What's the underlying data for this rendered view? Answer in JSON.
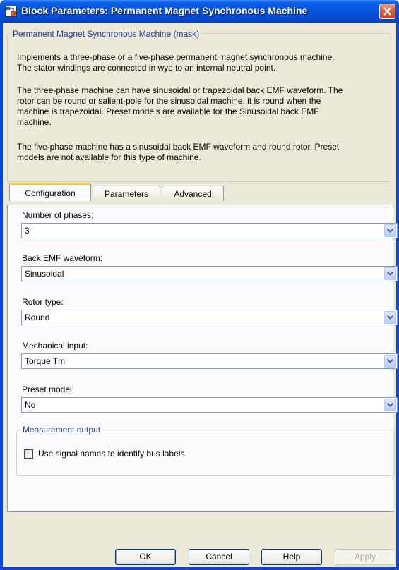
{
  "window": {
    "title": "Block Parameters: Permanent Magnet Synchronous Machine",
    "mask_title": "Permanent Magnet Synchronous Machine (mask)",
    "description": [
      "Implements a three-phase or a five-phase permanent magnet synchronous machine.",
      "The stator windings are connected in wye to an internal neutral point.",
      "The three-phase machine can have sinusoidal or trapezoidal back EMF waveform. The",
      "rotor can be round or salient-pole for the sinusoidal machine, it is round when the",
      "machine is trapezoidal. Preset models are available for the Sinusoidal back EMF",
      "machine.",
      "The five-phase machine has a sinusoidal back EMF waveform and round rotor. Preset",
      "models are not available for this type of machine."
    ]
  },
  "tabs": [
    {
      "label": "Configuration",
      "active": true
    },
    {
      "label": "Parameters",
      "active": false
    },
    {
      "label": "Advanced",
      "active": false
    }
  ],
  "fields": [
    {
      "label": "Number of phases:",
      "value": "3"
    },
    {
      "label": "Back EMF waveform:",
      "value": "Sinusoidal"
    },
    {
      "label": "Rotor type:",
      "value": "Round"
    },
    {
      "label": "Mechanical input:",
      "value": "Torque Tm"
    },
    {
      "label": "Preset model:",
      "value": "No"
    }
  ],
  "measurement": {
    "legend": "Measurement output",
    "checkbox_label": "Use signal names to identify bus labels",
    "checked": false
  },
  "buttons": {
    "ok": "OK",
    "cancel": "Cancel",
    "help": "Help",
    "apply": "Apply"
  },
  "colors": {
    "titlebar": "#0653da",
    "dialog_bg": "#ece9d8",
    "group_label": "#1f3c9c",
    "active_tab_accent": "#ffc83c"
  }
}
